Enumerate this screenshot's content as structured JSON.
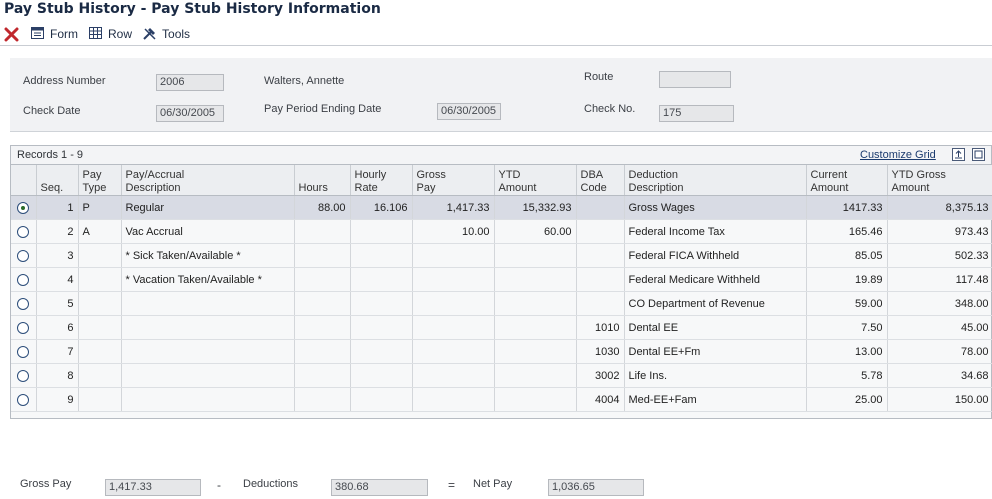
{
  "window": {
    "title": "Pay Stub History - Pay Stub History Information"
  },
  "toolbar": {
    "form_label": "Form",
    "row_label": "Row",
    "tools_label": "Tools"
  },
  "header": {
    "address_number_label": "Address Number",
    "address_number": "2006",
    "employee_name": "Walters, Annette",
    "route_label": "Route",
    "route": "",
    "check_date_label": "Check Date",
    "check_date": "06/30/2005",
    "pay_period_label": "Pay Period Ending Date",
    "pay_period_end": "06/30/2005",
    "check_no_label": "Check No.",
    "check_no": "175"
  },
  "grid": {
    "records_label": "Records 1 - 9",
    "customize_label": "Customize Grid",
    "columns": {
      "seq": "Seq.",
      "pay_type": [
        "Pay",
        "Type"
      ],
      "pay_desc": [
        "Pay/Accrual",
        "Description"
      ],
      "hours": "Hours",
      "hourly_rate": [
        "Hourly",
        "Rate"
      ],
      "gross_pay": [
        "Gross",
        "Pay"
      ],
      "ytd_amount": [
        "YTD",
        "Amount"
      ],
      "dba_code": [
        "DBA",
        "Code"
      ],
      "ded_desc": [
        "Deduction",
        "Description"
      ],
      "current_amount": [
        "Current",
        "Amount"
      ],
      "ytd_gross": [
        "YTD Gross",
        "Amount"
      ]
    },
    "rows": [
      {
        "seq": "1",
        "pay_type": "P",
        "pay_desc": "Regular",
        "hours": "88.00",
        "hourly_rate": "16.106",
        "gross_pay": "1,417.33",
        "ytd_amount": "15,332.93",
        "dba_code": "",
        "ded_desc": "Gross Wages",
        "current_amount": "1417.33",
        "ytd_gross": "8,375.13"
      },
      {
        "seq": "2",
        "pay_type": "A",
        "pay_desc": "Vac Accrual",
        "hours": "",
        "hourly_rate": "",
        "gross_pay": "10.00",
        "ytd_amount": "60.00",
        "dba_code": "",
        "ded_desc": "Federal Income Tax",
        "current_amount": "165.46",
        "ytd_gross": "973.43"
      },
      {
        "seq": "3",
        "pay_type": "",
        "pay_desc": "* Sick Taken/Available *",
        "hours": "",
        "hourly_rate": "",
        "gross_pay": "",
        "ytd_amount": "",
        "dba_code": "",
        "ded_desc": "Federal FICA Withheld",
        "current_amount": "85.05",
        "ytd_gross": "502.33"
      },
      {
        "seq": "4",
        "pay_type": "",
        "pay_desc": "* Vacation Taken/Available *",
        "hours": "",
        "hourly_rate": "",
        "gross_pay": "",
        "ytd_amount": "",
        "dba_code": "",
        "ded_desc": "Federal Medicare Withheld",
        "current_amount": "19.89",
        "ytd_gross": "117.48"
      },
      {
        "seq": "5",
        "pay_type": "",
        "pay_desc": "",
        "hours": "",
        "hourly_rate": "",
        "gross_pay": "",
        "ytd_amount": "",
        "dba_code": "",
        "ded_desc": "CO Department of Revenue",
        "current_amount": "59.00",
        "ytd_gross": "348.00"
      },
      {
        "seq": "6",
        "pay_type": "",
        "pay_desc": "",
        "hours": "",
        "hourly_rate": "",
        "gross_pay": "",
        "ytd_amount": "",
        "dba_code": "1010",
        "ded_desc": "Dental EE",
        "current_amount": "7.50",
        "ytd_gross": "45.00"
      },
      {
        "seq": "7",
        "pay_type": "",
        "pay_desc": "",
        "hours": "",
        "hourly_rate": "",
        "gross_pay": "",
        "ytd_amount": "",
        "dba_code": "1030",
        "ded_desc": "Dental EE+Fm",
        "current_amount": "13.00",
        "ytd_gross": "78.00"
      },
      {
        "seq": "8",
        "pay_type": "",
        "pay_desc": "",
        "hours": "",
        "hourly_rate": "",
        "gross_pay": "",
        "ytd_amount": "",
        "dba_code": "3002",
        "ded_desc": "Life Ins.",
        "current_amount": "5.78",
        "ytd_gross": "34.68"
      },
      {
        "seq": "9",
        "pay_type": "",
        "pay_desc": "",
        "hours": "",
        "hourly_rate": "",
        "gross_pay": "",
        "ytd_amount": "",
        "dba_code": "4004",
        "ded_desc": "Med-EE+Fam",
        "current_amount": "25.00",
        "ytd_gross": "150.00"
      }
    ]
  },
  "totals": {
    "gross_pay_label": "Gross Pay",
    "gross_pay": "1,417.33",
    "minus": "-",
    "deductions_label": "Deductions",
    "deductions": "380.68",
    "equals": "=",
    "net_pay_label": "Net Pay",
    "net_pay": "1,036.65"
  },
  "colors": {
    "selected_row": "#d8dbe4",
    "header_panel": "#f1f2f4",
    "close_icon": "#c0282d",
    "link": "#1a3a6e"
  },
  "icons": [
    "close-icon",
    "form-icon",
    "row-icon",
    "tools-icon",
    "export-icon",
    "maximize-grid-icon",
    "radio-icon"
  ]
}
